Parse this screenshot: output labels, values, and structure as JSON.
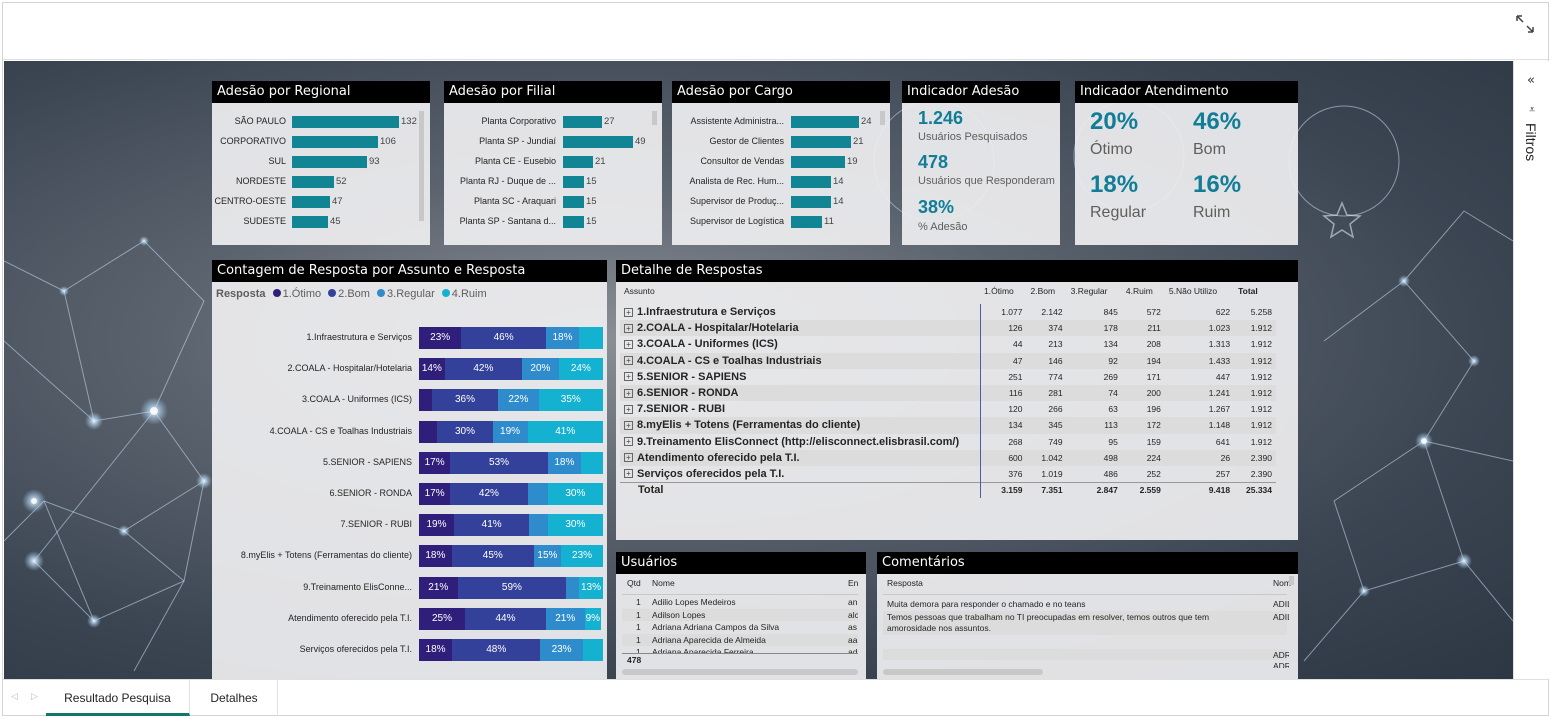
{
  "header": {
    "expand_icon": "expand-arrows-icon"
  },
  "filters": {
    "collapse_glyph": "«",
    "filter_glyph": "⩡",
    "label": "Filtros"
  },
  "tabs": [
    {
      "label": "Resultado Pesquisa",
      "active": true
    },
    {
      "label": "Detalhes",
      "active": false
    }
  ],
  "colors": {
    "bar": "#128594",
    "otimo": "#2f1f7a",
    "bom": "#33419a",
    "regular": "#2f8ccc",
    "ruim": "#14b1d0",
    "kpi": "#117d96"
  },
  "regional": {
    "title": "Adesão por Regional",
    "rows": [
      {
        "label": "SÃO PAULO",
        "value": 132
      },
      {
        "label": "CORPORATIVO",
        "value": 106
      },
      {
        "label": "SUL",
        "value": 93
      },
      {
        "label": "NORDESTE",
        "value": 52
      },
      {
        "label": "CENTRO-OESTE",
        "value": 47
      },
      {
        "label": "SUDESTE",
        "value": 45
      }
    ],
    "max": 132
  },
  "filial": {
    "title": "Adesão por Filial",
    "rows": [
      {
        "label": "Planta Corporativo",
        "value": 27
      },
      {
        "label": "Planta SP - Jundiaí",
        "value": 49
      },
      {
        "label": "Planta CE - Eusebio",
        "value": 21
      },
      {
        "label": "Planta RJ - Duque de ...",
        "value": 15
      },
      {
        "label": "Planta SC - Araquari",
        "value": 15
      },
      {
        "label": "Planta SP - Santana d...",
        "value": 15
      }
    ],
    "max": 49
  },
  "cargo": {
    "title": "Adesão por Cargo",
    "rows": [
      {
        "label": "Assistente Administra...",
        "value": 24
      },
      {
        "label": "Gestor de Clientes",
        "value": 21
      },
      {
        "label": "Consultor de Vendas",
        "value": 19
      },
      {
        "label": "Analista de Rec. Hum...",
        "value": 14
      },
      {
        "label": "Supervisor de Produç...",
        "value": 14
      },
      {
        "label": "Supervisor de Logística",
        "value": 11
      }
    ],
    "max": 24
  },
  "adesao": {
    "title": "Indicador Adesão",
    "users_value": "1.246",
    "users_label": "Usuários Pesquisados",
    "resp_value": "478",
    "resp_label": "Usuários que Responderam",
    "pct_value": "38%",
    "pct_label": "% Adesão"
  },
  "atendimento": {
    "title": "Indicador Atendimento",
    "otimo_value": "20%",
    "otimo_label": "Ótimo",
    "bom_value": "46%",
    "bom_label": "Bom",
    "regular_value": "18%",
    "regular_label": "Regular",
    "ruim_value": "16%",
    "ruim_label": "Ruim"
  },
  "contagem": {
    "title": "Contagem de Resposta por Assunto e Resposta",
    "legend_title": "Resposta",
    "legend": [
      "1.Ótimo",
      "2.Bom",
      "3.Regular",
      "4.Ruim"
    ],
    "rows": [
      {
        "label": "1.Infraestrutura e Serviços",
        "pct": [
          23,
          46,
          18,
          13
        ],
        "labels": [
          "23%",
          "46%",
          "18%",
          ""
        ]
      },
      {
        "label": "2.COALA - Hospitalar/Hotelaria",
        "pct": [
          14,
          42,
          20,
          24
        ],
        "labels": [
          "14%",
          "42%",
          "20%",
          "24%"
        ]
      },
      {
        "label": "3.COALA - Uniformes (ICS)",
        "pct": [
          7,
          36,
          22,
          35
        ],
        "labels": [
          "",
          "36%",
          "22%",
          "35%"
        ]
      },
      {
        "label": "4.COALA - CS e Toalhas Industriais",
        "pct": [
          10,
          30,
          19,
          41
        ],
        "labels": [
          "",
          "30%",
          "19%",
          "41%"
        ]
      },
      {
        "label": "5.SENIOR - SAPIENS",
        "pct": [
          17,
          53,
          18,
          12
        ],
        "labels": [
          "17%",
          "53%",
          "18%",
          ""
        ]
      },
      {
        "label": "6.SENIOR - RONDA",
        "pct": [
          17,
          42,
          11,
          30
        ],
        "labels": [
          "17%",
          "42%",
          "",
          "30%"
        ]
      },
      {
        "label": "7.SENIOR - RUBI",
        "pct": [
          19,
          41,
          10,
          30
        ],
        "labels": [
          "19%",
          "41%",
          "",
          "30%"
        ]
      },
      {
        "label": "8.myElis + Totens (Ferramentas do cliente)",
        "pct": [
          18,
          45,
          15,
          23
        ],
        "labels": [
          "18%",
          "45%",
          "15%",
          "23%"
        ]
      },
      {
        "label": "9.Treinamento ElisConne...",
        "pct": [
          21,
          59,
          7,
          13
        ],
        "labels": [
          "21%",
          "59%",
          "",
          "13%"
        ]
      },
      {
        "label": "Atendimento oferecido pela T.I.",
        "pct": [
          25,
          44,
          21,
          9
        ],
        "labels": [
          "25%",
          "44%",
          "21%",
          "9%"
        ]
      },
      {
        "label": "Serviços oferecidos pela T.I.",
        "pct": [
          18,
          48,
          23,
          11
        ],
        "labels": [
          "18%",
          "48%",
          "23%",
          ""
        ]
      }
    ]
  },
  "detalhe": {
    "title": "Detalhe de Respostas",
    "headers": [
      "Assunto",
      "1.Ótimo",
      "2.Bom",
      "3.Regular",
      "4.Ruim",
      "5.Não Utilizo",
      "Total"
    ],
    "rows": [
      [
        "1.Infraestrutura e Serviços",
        "1.077",
        "2.142",
        "845",
        "572",
        "622",
        "5.258"
      ],
      [
        "2.COALA - Hospitalar/Hotelaria",
        "126",
        "374",
        "178",
        "211",
        "1.023",
        "1.912"
      ],
      [
        "3.COALA - Uniformes (ICS)",
        "44",
        "213",
        "134",
        "208",
        "1.313",
        "1.912"
      ],
      [
        "4.COALA - CS e Toalhas Industriais",
        "47",
        "146",
        "92",
        "194",
        "1.433",
        "1.912"
      ],
      [
        "5.SENIOR - SAPIENS",
        "251",
        "774",
        "269",
        "171",
        "447",
        "1.912"
      ],
      [
        "6.SENIOR - RONDA",
        "116",
        "281",
        "74",
        "200",
        "1.241",
        "1.912"
      ],
      [
        "7.SENIOR - RUBI",
        "120",
        "266",
        "63",
        "196",
        "1.267",
        "1.912"
      ],
      [
        "8.myElis + Totens (Ferramentas do cliente)",
        "134",
        "345",
        "113",
        "172",
        "1.148",
        "1.912"
      ],
      [
        "9.Treinamento ElisConnect (http://elisconnect.elisbrasil.com/)",
        "268",
        "749",
        "95",
        "159",
        "641",
        "1.912"
      ],
      [
        "Atendimento oferecido pela T.I.",
        "600",
        "1.042",
        "498",
        "224",
        "26",
        "2.390"
      ],
      [
        "Serviços oferecidos pela T.I.",
        "376",
        "1.019",
        "486",
        "252",
        "257",
        "2.390"
      ]
    ],
    "total": [
      "Total",
      "3.159",
      "7.351",
      "2.847",
      "2.559",
      "9.418",
      "25.334"
    ]
  },
  "usuarios": {
    "title": "Usuários",
    "headers": [
      "Qtd",
      "Nome",
      "En"
    ],
    "rows": [
      [
        "1",
        "Adilio Lopes Medeiros",
        "an"
      ],
      [
        "1",
        "Adilson Lopes",
        "alc"
      ],
      [
        "1",
        "Adriana Adriana Campos da Silva",
        "as"
      ],
      [
        "1",
        "Adriana Aparecida de Almeida",
        "aa"
      ],
      [
        "1",
        "Adriana Aparecida Ferreira",
        "ad"
      ]
    ],
    "total": "478"
  },
  "comentarios": {
    "title": "Comentários",
    "headers": [
      "Resposta",
      "Nom"
    ],
    "rows": [
      [
        "Muita demora para responder o chamado e no teans",
        "ADIL"
      ],
      [
        "Temos pessoas que trabalham no TI preocupadas em resolver, temos outros que tem amorosidade nos assuntos.",
        "ADIL"
      ],
      [
        "",
        ""
      ],
      [
        "",
        "ADR"
      ],
      [
        "",
        "ADR"
      ],
      [
        "",
        "ADR"
      ]
    ]
  }
}
